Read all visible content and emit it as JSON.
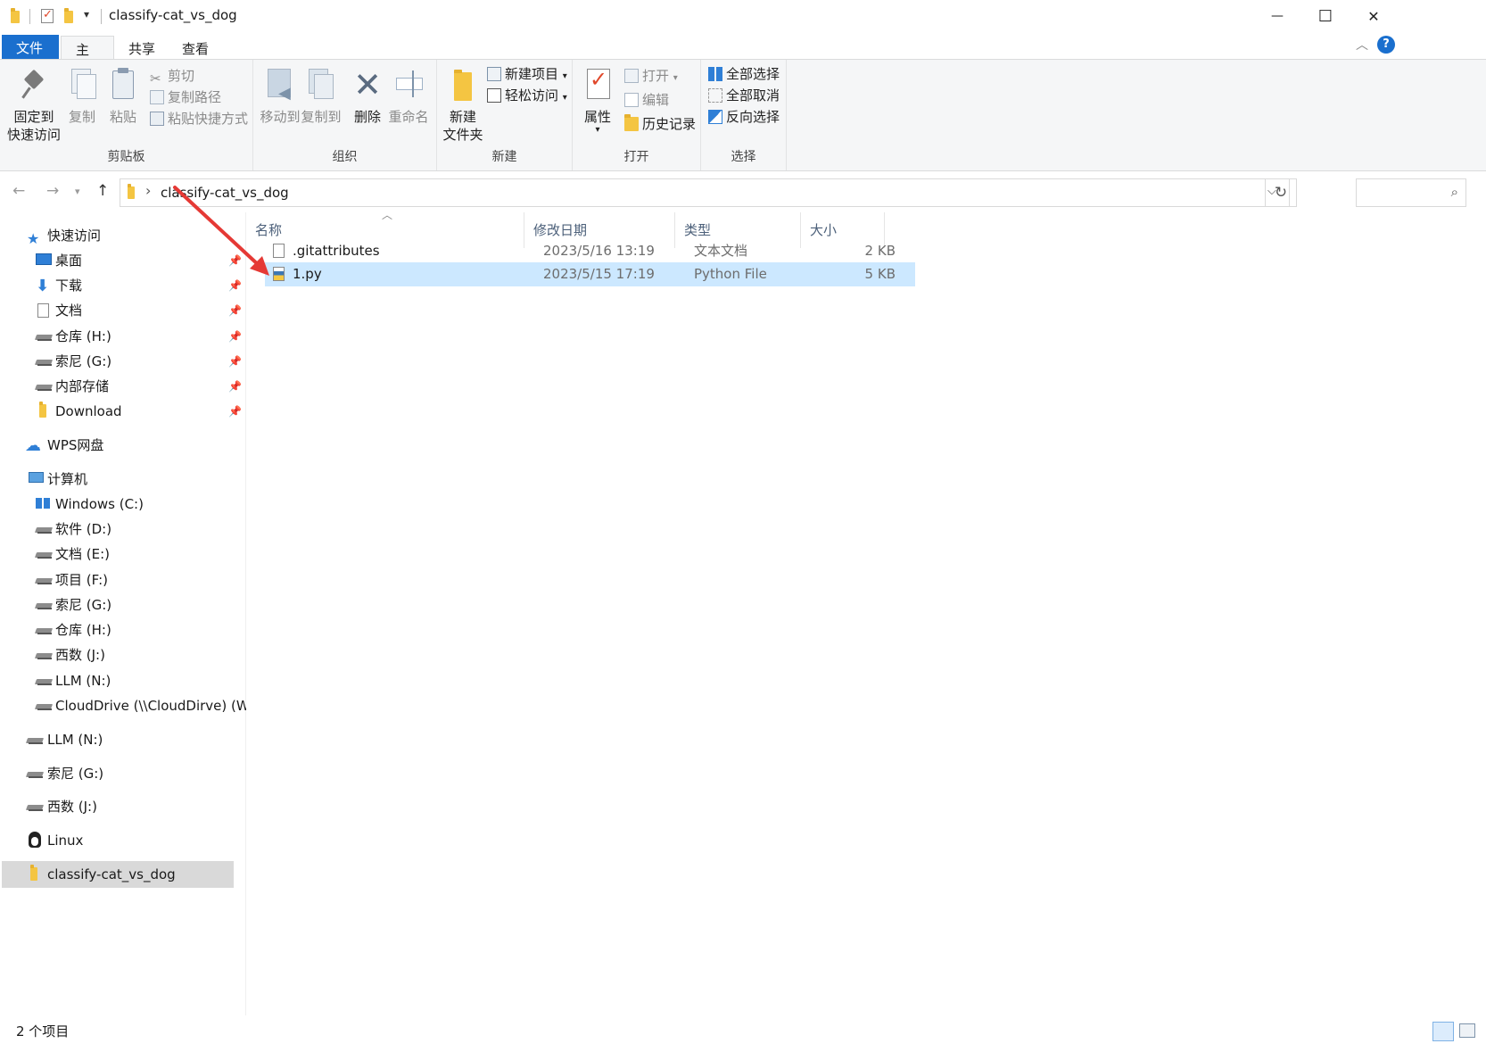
{
  "window": {
    "title": "classify-cat_vs_dog",
    "minimize": "—",
    "maximize": "☐",
    "close": "✕"
  },
  "ribbon_tabs": [
    {
      "label": "文件"
    },
    {
      "label": "主页"
    },
    {
      "label": "共享"
    },
    {
      "label": "查看"
    }
  ],
  "ribbon": {
    "clipboard": {
      "pin_l1": "固定到",
      "pin_l2": "快速访问",
      "copy": "复制",
      "paste": "粘贴",
      "cut": "剪切",
      "copy_path": "复制路径",
      "paste_shortcut": "粘贴快捷方式",
      "label": "剪贴板"
    },
    "organize": {
      "move_to": "移动到",
      "copy_to": "复制到",
      "delete": "删除",
      "rename": "重命名",
      "label": "组织"
    },
    "new": {
      "new_folder_l1": "新建",
      "new_folder_l2": "文件夹",
      "new_item": "新建项目",
      "easy_access": "轻松访问",
      "label": "新建"
    },
    "open": {
      "properties": "属性",
      "open": "打开",
      "edit": "编辑",
      "history": "历史记录",
      "label": "打开"
    },
    "select": {
      "select_all": "全部选择",
      "select_none": "全部取消",
      "invert": "反向选择",
      "label": "选择"
    }
  },
  "address": {
    "path": "classify-cat_vs_dog",
    "separator": "›"
  },
  "nav_pane": {
    "quick_access": "快速访问",
    "quick_items": [
      {
        "label": "桌面",
        "icon": "desktop-icon"
      },
      {
        "label": "下载",
        "icon": "download-icon"
      },
      {
        "label": "文档",
        "icon": "document-icon"
      },
      {
        "label": "仓库 (H:)",
        "icon": "drive-icon"
      },
      {
        "label": "索尼 (G:)",
        "icon": "drive-icon"
      },
      {
        "label": "内部存储",
        "icon": "drive-icon"
      },
      {
        "label": "Download",
        "icon": "folder-icon"
      }
    ],
    "wps": "WPS网盘",
    "computer": "计算机",
    "computer_items": [
      {
        "label": "Windows (C:)",
        "icon": "windows-drive-icon"
      },
      {
        "label": "软件 (D:)",
        "icon": "drive-icon"
      },
      {
        "label": "文档 (E:)",
        "icon": "drive-icon"
      },
      {
        "label": "项目 (F:)",
        "icon": "drive-icon"
      },
      {
        "label": "索尼 (G:)",
        "icon": "drive-icon"
      },
      {
        "label": "仓库 (H:)",
        "icon": "drive-icon"
      },
      {
        "label": "西数 (J:)",
        "icon": "drive-icon"
      },
      {
        "label": "LLM (N:)",
        "icon": "drive-icon"
      },
      {
        "label": "CloudDrive (\\\\CloudDirve) (W",
        "icon": "network-drive-icon"
      }
    ],
    "root_items": [
      {
        "label": "LLM (N:)"
      },
      {
        "label": "索尼 (G:)"
      },
      {
        "label": "西数 (J:)"
      },
      {
        "label": "Linux"
      },
      {
        "label": "classify-cat_vs_dog"
      }
    ]
  },
  "columns": {
    "name": "名称",
    "date": "修改日期",
    "type": "类型",
    "size": "大小"
  },
  "files": [
    {
      "name": ".gitattributes",
      "date": "2023/5/16 13:19",
      "type": "文本文档",
      "size": "2 KB",
      "selected": false
    },
    {
      "name": "1.py",
      "date": "2023/5/15 17:19",
      "type": "Python File",
      "size": "5 KB",
      "selected": true
    }
  ],
  "status": {
    "count": "2 个项目"
  },
  "colors": {
    "accent": "#1a6fce",
    "selected_row": "#cce8ff",
    "annotation_arrow": "#e53935"
  }
}
